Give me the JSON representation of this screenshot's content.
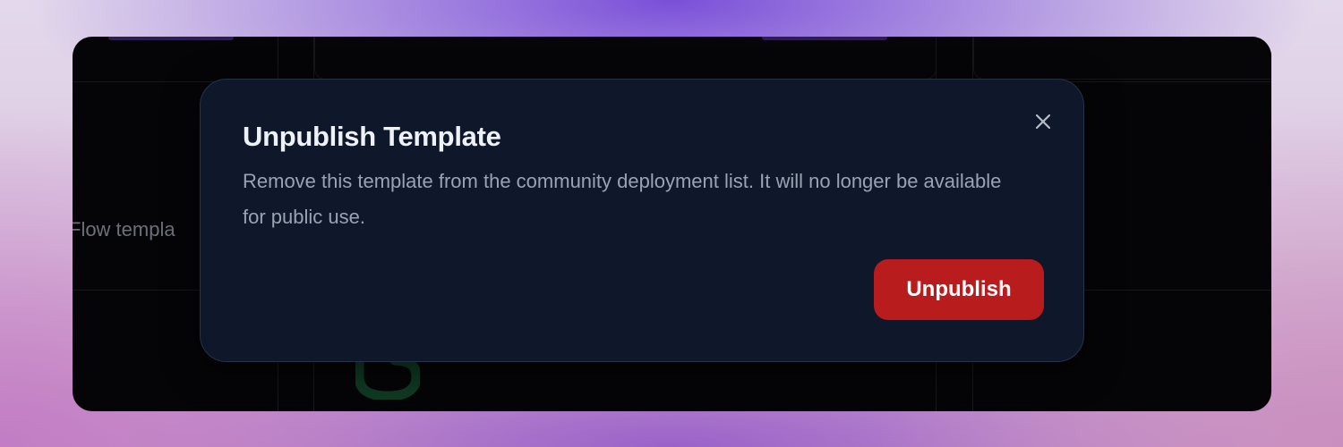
{
  "background": {
    "partial_text": "Flow templa"
  },
  "modal": {
    "title": "Unpublish Template",
    "description": "Remove this template from the community deployment list. It will no longer be available for public use.",
    "close_icon": "close-icon",
    "primary_action": "Unpublish"
  },
  "colors": {
    "modal_background": "#0f172a",
    "danger_button": "#b91c1c",
    "app_background": "#050507"
  }
}
